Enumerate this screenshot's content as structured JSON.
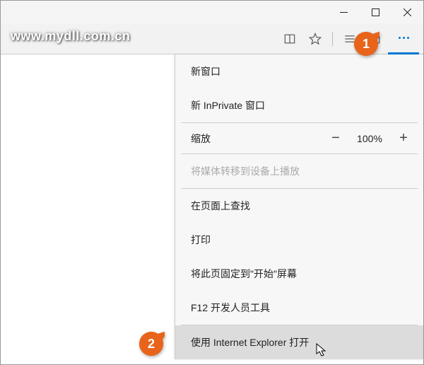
{
  "watermark": "www.mydll.com.cn",
  "zoom": {
    "label": "缩放",
    "value": "100%"
  },
  "menu": {
    "new_window": "新窗口",
    "new_inprivate": "新 InPrivate 窗口",
    "cast": "将媒体转移到设备上播放",
    "find": "在页面上查找",
    "print": "打印",
    "pin": "将此页固定到\"开始\"屏幕",
    "devtools": "F12 开发人员工具",
    "open_ie": "使用 Internet Explorer 打开"
  },
  "callouts": {
    "c1": "1",
    "c2": "2"
  }
}
